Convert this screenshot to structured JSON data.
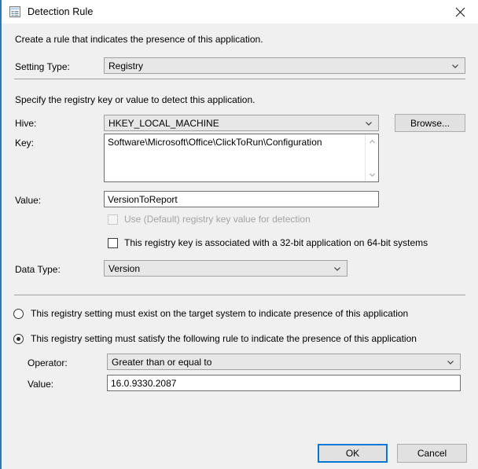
{
  "window": {
    "title": "Detection Rule",
    "icon": "registry-rule-icon",
    "close_icon": "close-icon",
    "accent_color": "#0078d7"
  },
  "intro_text": "Create a rule that indicates the presence of this application.",
  "setting_type": {
    "label": "Setting Type:",
    "value": "Registry",
    "chevron_icon": "chevron-down-icon"
  },
  "registry_section": {
    "instruction": "Specify the registry key or value to detect this application.",
    "hive": {
      "label": "Hive:",
      "value": "HKEY_LOCAL_MACHINE",
      "chevron_icon": "chevron-down-icon"
    },
    "browse_button": "Browse...",
    "key": {
      "label": "Key:",
      "value": "Software\\Microsoft\\Office\\ClickToRun\\Configuration",
      "scroll_up_icon": "chevron-up-icon",
      "scroll_down_icon": "chevron-down-icon"
    },
    "value_field": {
      "label": "Value:",
      "value": "VersionToReport"
    },
    "default_key_checkbox": {
      "label": "Use (Default) registry key value for detection",
      "checked": false,
      "disabled": true
    },
    "wow64_checkbox": {
      "label": "This registry key is associated with a 32-bit application on 64-bit systems",
      "checked": false,
      "disabled": false
    },
    "data_type": {
      "label": "Data Type:",
      "value": "Version",
      "chevron_icon": "chevron-down-icon"
    }
  },
  "rule_section": {
    "option_exists": {
      "label": "This registry setting must exist on the target system to indicate presence of this application",
      "selected": false
    },
    "option_satisfy": {
      "label": "This registry setting must satisfy the following rule to indicate the presence of this application",
      "selected": true
    },
    "operator": {
      "label": "Operator:",
      "value": "Greater than or equal to",
      "chevron_icon": "chevron-down-icon"
    },
    "rule_value": {
      "label": "Value:",
      "value": "16.0.9330.2087"
    }
  },
  "footer": {
    "ok_button": "OK",
    "cancel_button": "Cancel"
  }
}
